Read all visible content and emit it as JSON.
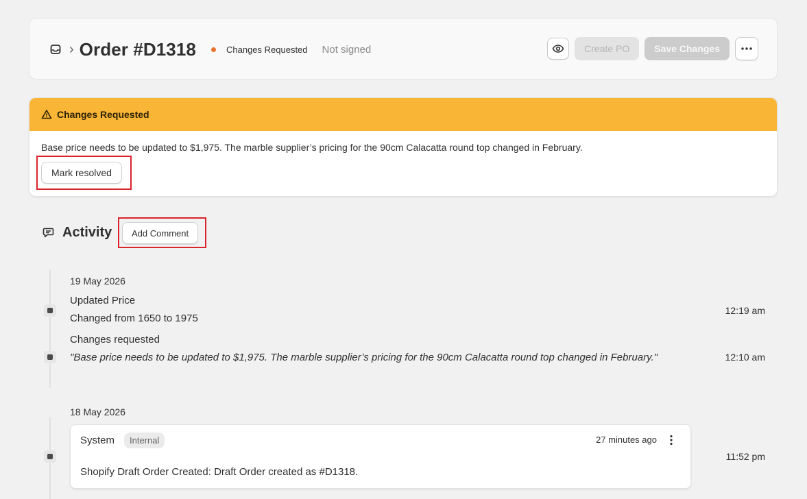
{
  "header": {
    "title": "Order #D1318",
    "breadcrumb_sep": "›",
    "status": "Changes Requested",
    "status_color": "#e8732c",
    "signature": "Not signed",
    "create_po_label": "Create PO",
    "save_label": "Save Changes",
    "icons": {
      "breadcrumb": "inbox-icon",
      "preview": "eye-icon",
      "more": "more-horizontal-icon"
    }
  },
  "banner": {
    "title": "Changes Requested",
    "color": "#f9b535",
    "message": "Base price needs to be updated to $1,975. The marble supplier’s pricing for the 90cm Calacatta round top changed in February.",
    "resolve_label": "Mark resolved",
    "icon": "warning-triangle-icon"
  },
  "activity": {
    "title": "Activity",
    "add_comment_label": "Add Comment",
    "icon": "comment-icon",
    "groups": [
      {
        "date": "19 May 2026",
        "events": [
          {
            "title": "Updated Price",
            "detail": "Changed from 1650 to 1975",
            "time": "12:19 am"
          },
          {
            "title": "Changes requested",
            "quote": "\"Base price needs to be updated to $1,975. The marble supplier’s pricing for the 90cm Calacatta round top changed in February.\"",
            "time": "12:10 am"
          }
        ]
      },
      {
        "date": "18 May 2026",
        "events": [
          {
            "author": "System",
            "badge": "Internal",
            "ago": "27 minutes ago",
            "body": "Shopify Draft Order Created: Draft Order created as #D1318.",
            "time": "11:52 pm"
          }
        ]
      }
    ]
  }
}
